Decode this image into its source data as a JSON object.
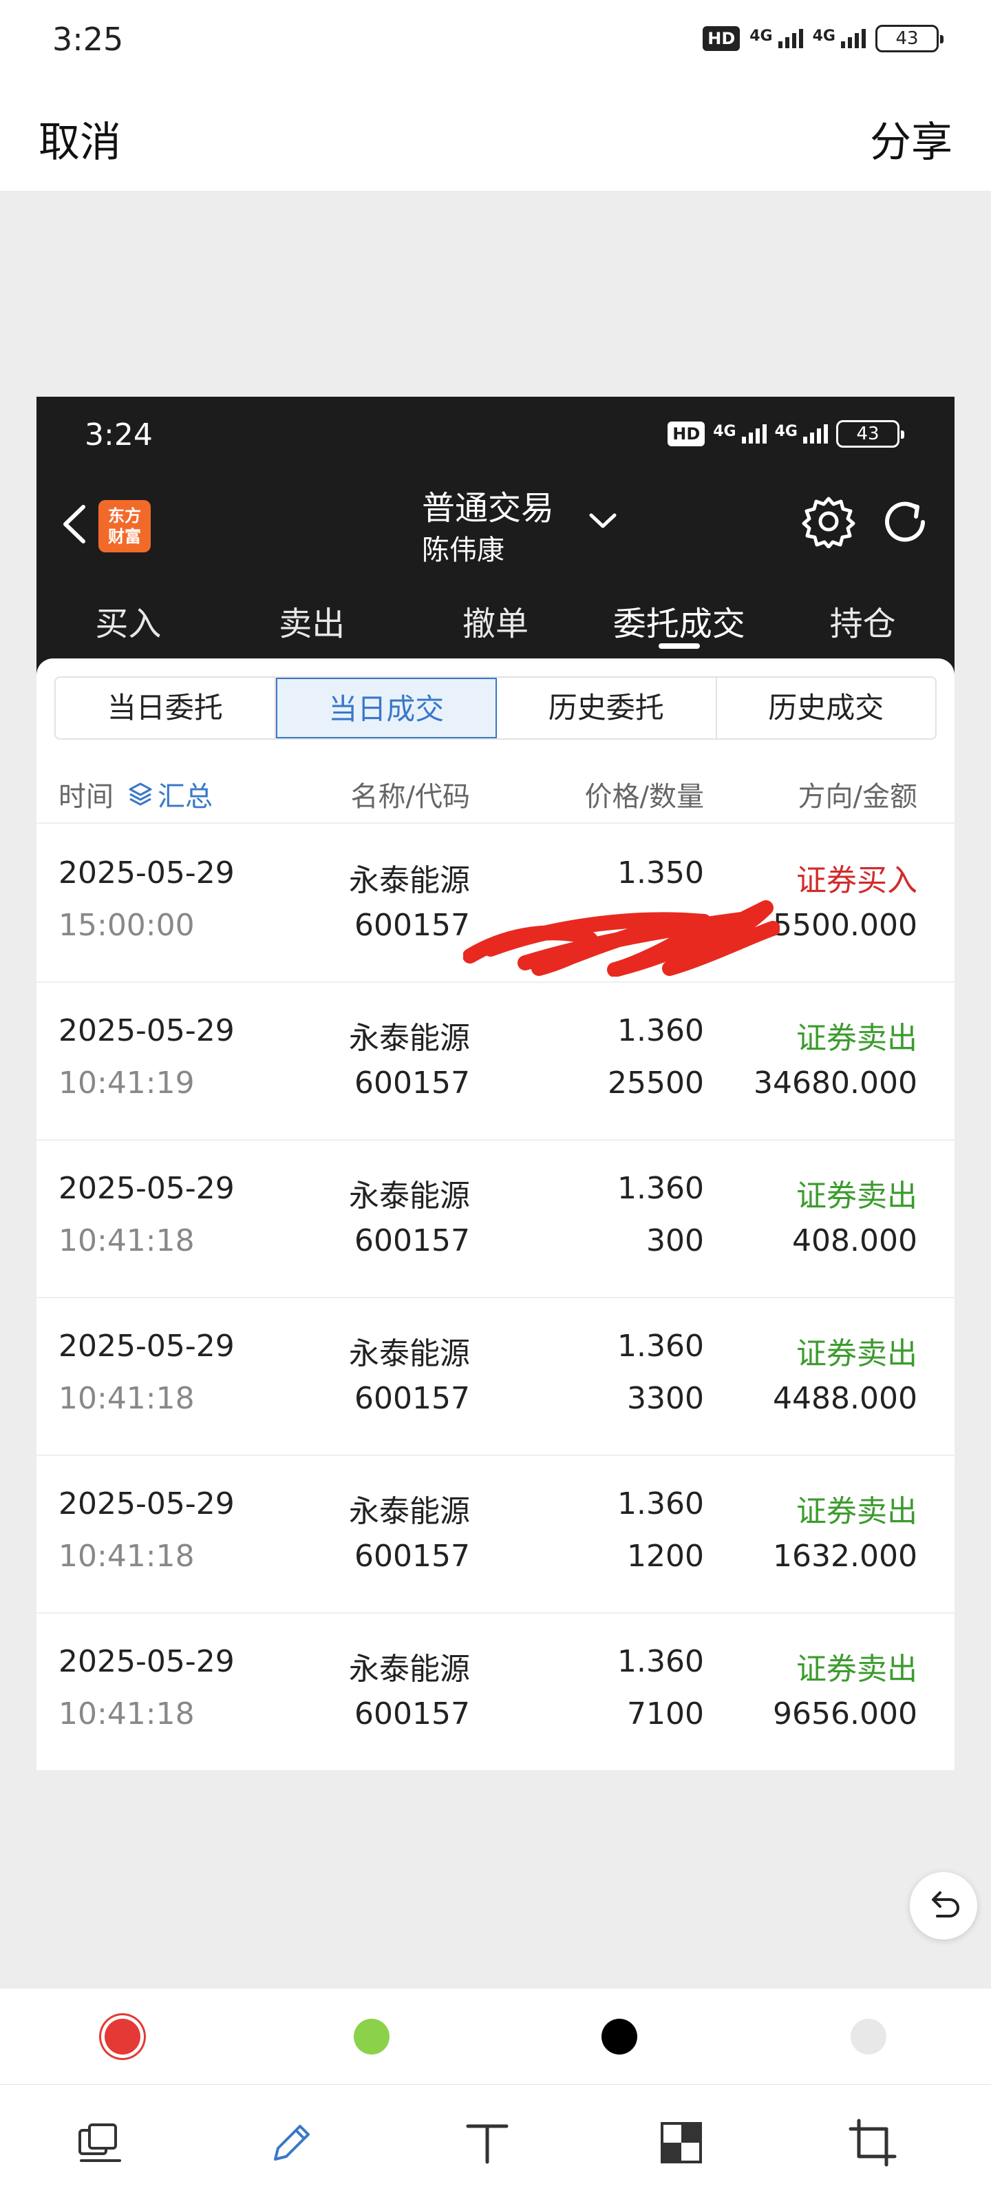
{
  "status_bar": {
    "time": "3:25",
    "hd": "HD",
    "net1": "4G",
    "net2": "4G",
    "battery": "43"
  },
  "editor": {
    "cancel_label": "取消",
    "share_label": "分享"
  },
  "screenshot": {
    "status_bar": {
      "time": "3:24",
      "hd": "HD",
      "net1": "4G",
      "net2": "4G",
      "battery": "43"
    },
    "header": {
      "logo_line1": "东方",
      "logo_line2": "财富",
      "title": "普通交易",
      "subtitle": "陈伟康"
    },
    "nav_tabs": [
      "买入",
      "卖出",
      "撤单",
      "委托成交",
      "持仓"
    ],
    "sub_tabs": [
      "当日委托",
      "当日成交",
      "历史委托",
      "历史成交"
    ],
    "columns": {
      "time": "时间",
      "summary": "汇总",
      "name": "名称/代码",
      "price": "价格/数量",
      "direction": "方向/金额"
    },
    "rows": [
      {
        "date": "2025-05-29",
        "time": "15:00:00",
        "name": "永泰能源",
        "code": "600157",
        "price": "1.350",
        "qty": "",
        "direction": "证券买入",
        "amount": "5500.000",
        "type": "buy"
      },
      {
        "date": "2025-05-29",
        "time": "10:41:19",
        "name": "永泰能源",
        "code": "600157",
        "price": "1.360",
        "qty": "25500",
        "direction": "证券卖出",
        "amount": "34680.000",
        "type": "sell"
      },
      {
        "date": "2025-05-29",
        "time": "10:41:18",
        "name": "永泰能源",
        "code": "600157",
        "price": "1.360",
        "qty": "300",
        "direction": "证券卖出",
        "amount": "408.000",
        "type": "sell"
      },
      {
        "date": "2025-05-29",
        "time": "10:41:18",
        "name": "永泰能源",
        "code": "600157",
        "price": "1.360",
        "qty": "3300",
        "direction": "证券卖出",
        "amount": "4488.000",
        "type": "sell"
      },
      {
        "date": "2025-05-29",
        "time": "10:41:18",
        "name": "永泰能源",
        "code": "600157",
        "price": "1.360",
        "qty": "1200",
        "direction": "证券卖出",
        "amount": "1632.000",
        "type": "sell"
      },
      {
        "date": "2025-05-29",
        "time": "10:41:18",
        "name": "永泰能源",
        "code": "600157",
        "price": "1.360",
        "qty": "7100",
        "direction": "证券卖出",
        "amount": "9656.000",
        "type": "sell"
      }
    ]
  },
  "colors": {
    "buy": "#d22b2b",
    "sell": "#3c9b2e",
    "accent": "#3a78c9",
    "scribble": "#e8291f"
  },
  "palette": [
    "#e53935",
    "#8bd24a",
    "#000000",
    "#e8e8e8"
  ],
  "tool_icons": [
    "layers-icon",
    "pencil-icon",
    "text-icon",
    "mosaic-icon",
    "crop-icon"
  ]
}
